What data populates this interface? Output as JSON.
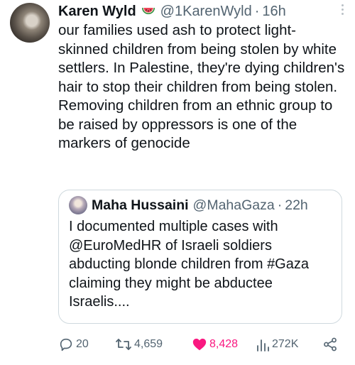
{
  "tweet": {
    "author_name": "Karen Wyld",
    "author_emoji": "watermelon-emoji",
    "handle": "@1KarenWyld",
    "separator": "·",
    "time": "16h",
    "text": "our families used ash to protect light-skinned children from being stolen by white settlers. In Palestine, they're dying children's hair to stop their children from being stolen. Removing children from an ethnic group to be raised by oppressors is one of the markers of genocide"
  },
  "quote": {
    "author_name": "Maha Hussaini",
    "handle": "@MahaGaza",
    "separator": "·",
    "time": "22h",
    "text": "I documented multiple cases with @EuroMedHR of Israeli soldiers abducting blonde children from #Gaza claiming they might be abductee Israelis...."
  },
  "actions": {
    "replies": "20",
    "reposts": "4,659",
    "likes": "8,428",
    "views": "272K",
    "icons": {
      "reply": "reply-icon",
      "repost": "repost-icon",
      "like": "heart-icon",
      "views": "views-icon",
      "share": "share-icon"
    }
  },
  "colors": {
    "text": "#0f1419",
    "secondary": "#536471",
    "like_active": "#f91880",
    "border": "#cfd9de"
  }
}
